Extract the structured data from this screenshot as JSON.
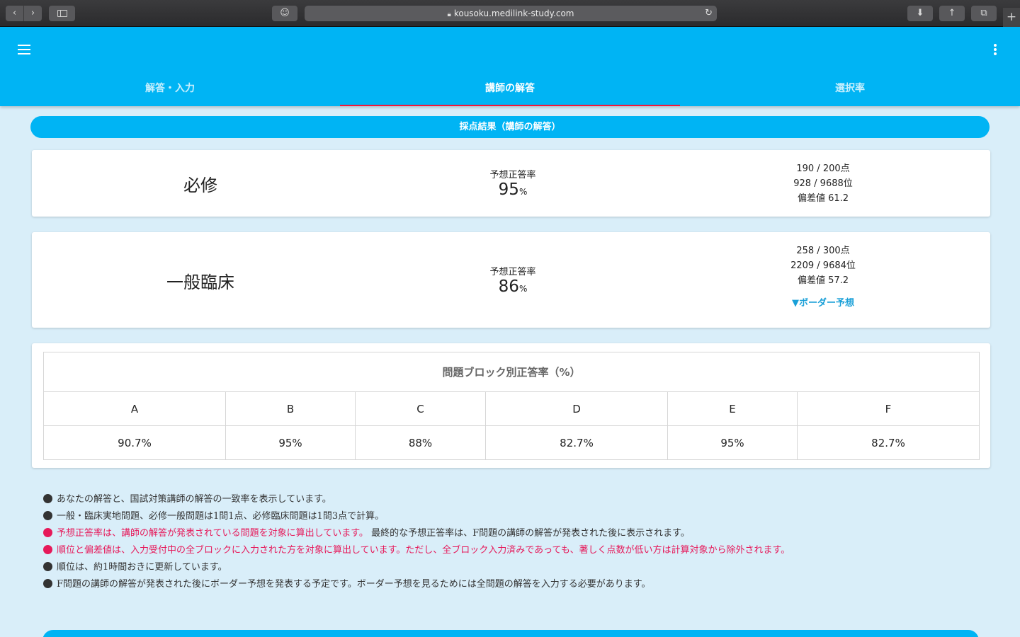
{
  "browser": {
    "url": "kousoku.medilink-study.com",
    "back_icon": "chevron-left-icon",
    "forward_icon": "chevron-right-icon"
  },
  "app": {
    "tabs": [
      {
        "label": "解答・入力"
      },
      {
        "label": "講師の解答"
      },
      {
        "label": "選択率"
      }
    ],
    "active_tab": 1,
    "accent_color": "#00b4f4",
    "tab_indicator_color": "#f2183a"
  },
  "result_header": "採点結果（講師の解答）",
  "scores": [
    {
      "subject": "必修",
      "rate_label": "予想正答率",
      "rate_value": "95",
      "rate_unit": "%",
      "points": "190 / 200点",
      "rank": "928 / 9688位",
      "deviation": "偏差値 61.2"
    },
    {
      "subject": "一般臨床",
      "rate_label": "予想正答率",
      "rate_value": "86",
      "rate_unit": "%",
      "points": "258 / 300点",
      "rank": "2209 / 9684位",
      "deviation": "偏差値 57.2",
      "border_link": "▼ボーダー予想"
    }
  ],
  "blocks_table": {
    "caption": "問題ブロック別正答率（%）",
    "headers": [
      "A",
      "B",
      "C",
      "D",
      "E",
      "F"
    ],
    "values": [
      "90.7%",
      "95%",
      "88%",
      "82.7%",
      "95%",
      "82.7%"
    ]
  },
  "notes": [
    {
      "text": "あなたの解答と、国試対策講師の解答の一致率を表示しています。",
      "extra": ""
    },
    {
      "text": "一般・臨床実地問題、必修一般問題は1問1点、必修臨床問題は1問3点で計算。",
      "extra": ""
    },
    {
      "text": "予想正答率は、講師の解答が発表されている問題を対象に算出しています。",
      "extra": "最終的な予想正答率は、F問題の講師の解答が発表された後に表示されます。"
    },
    {
      "text": "順位と偏差値は、入力受付中の全ブロックに入力された方を対象に算出しています。ただし、全ブロック入力済みであっても、著しく点数が低い方は計算対象から除外されます。",
      "extra": ""
    },
    {
      "text": "順位は、約1時間おきに更新しています。",
      "extra": ""
    },
    {
      "text": "F問題の講師の解答が発表された後にボーダー予想を発表する予定です。ボーダー予想を見るためには全問題の解答を入力する必要があります。",
      "extra": ""
    }
  ]
}
